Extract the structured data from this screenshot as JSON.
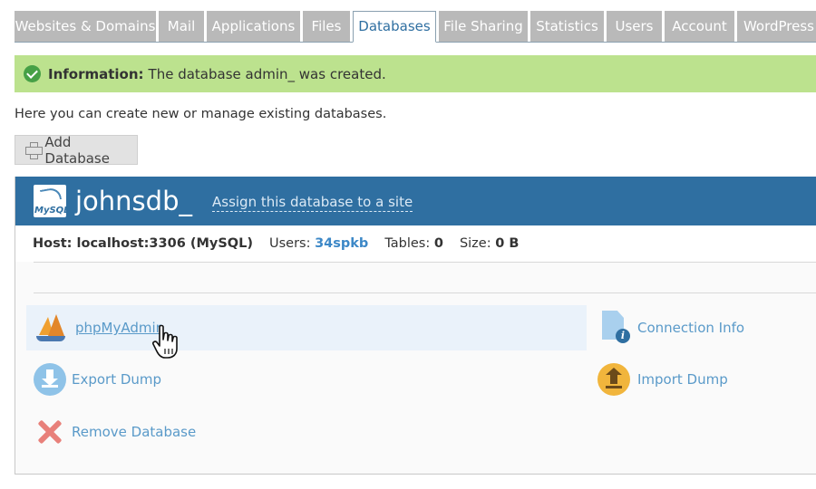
{
  "tabs": [
    {
      "label": "Websites & Domains",
      "active": false
    },
    {
      "label": "Mail",
      "active": false
    },
    {
      "label": "Applications",
      "active": false
    },
    {
      "label": "Files",
      "active": false
    },
    {
      "label": "Databases",
      "active": true
    },
    {
      "label": "File Sharing",
      "active": false
    },
    {
      "label": "Statistics",
      "active": false
    },
    {
      "label": "Users",
      "active": false
    },
    {
      "label": "Account",
      "active": false
    },
    {
      "label": "WordPress",
      "active": false
    }
  ],
  "info": {
    "title": "Information:",
    "message": "The database admin_ was created."
  },
  "intro": "Here you can create new or manage existing databases.",
  "toolbar": {
    "add_label": "Add Database"
  },
  "database": {
    "logo_text": "MySQL",
    "name": "johnsdb_",
    "assign_link": "Assign this database to a site",
    "host_label": "Host: localhost:3306 (MySQL)",
    "users_label": "Users:",
    "users_value": "34spkb",
    "tables_label": "Tables:",
    "tables_value": "0",
    "size_label": "Size:",
    "size_value": "0 B"
  },
  "actions": {
    "phpmyadmin": "phpMyAdmin",
    "connection_info": "Connection Info",
    "export_dump": "Export Dump",
    "import_dump": "Import Dump",
    "remove_database": "Remove Database"
  },
  "colors": {
    "accent": "#2f6fa1",
    "link": "#5a9ac9",
    "success_bg": "#bce28e",
    "tab_bg": "#b9b9b9"
  }
}
